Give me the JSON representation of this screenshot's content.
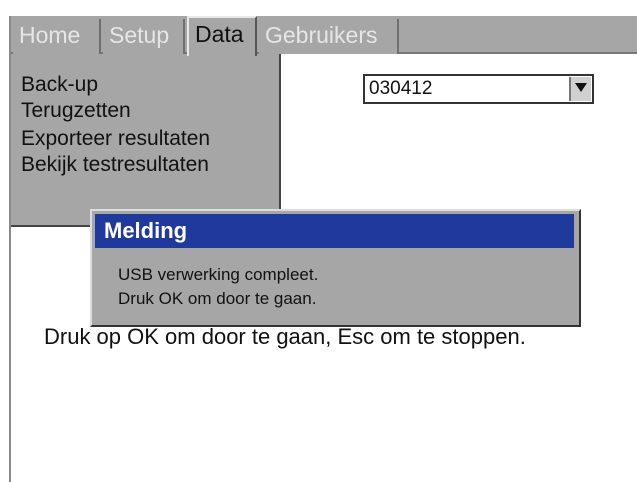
{
  "tabs": [
    {
      "label": "Home",
      "active": false
    },
    {
      "label": "Setup",
      "active": false
    },
    {
      "label": "Data",
      "active": true
    },
    {
      "label": "Gebruikers",
      "active": false
    }
  ],
  "menu": {
    "items": [
      "Back-up",
      "Terugzetten",
      "Exporteer resultaten",
      "Bekijk testresultaten"
    ]
  },
  "dropdown": {
    "value": "030412",
    "icon": "chevron-down-icon"
  },
  "hint": "Druk op OK om door te gaan, Esc om te stoppen.",
  "dialog": {
    "title": "Melding",
    "lines": [
      "USB verwerking compleet.",
      "Druk OK om door te gaan."
    ]
  },
  "colors": {
    "panel_gray": "#a6a6a6",
    "titlebar_blue": "#1f3a9c",
    "inactive_tab_text": "#e6e6e6"
  }
}
